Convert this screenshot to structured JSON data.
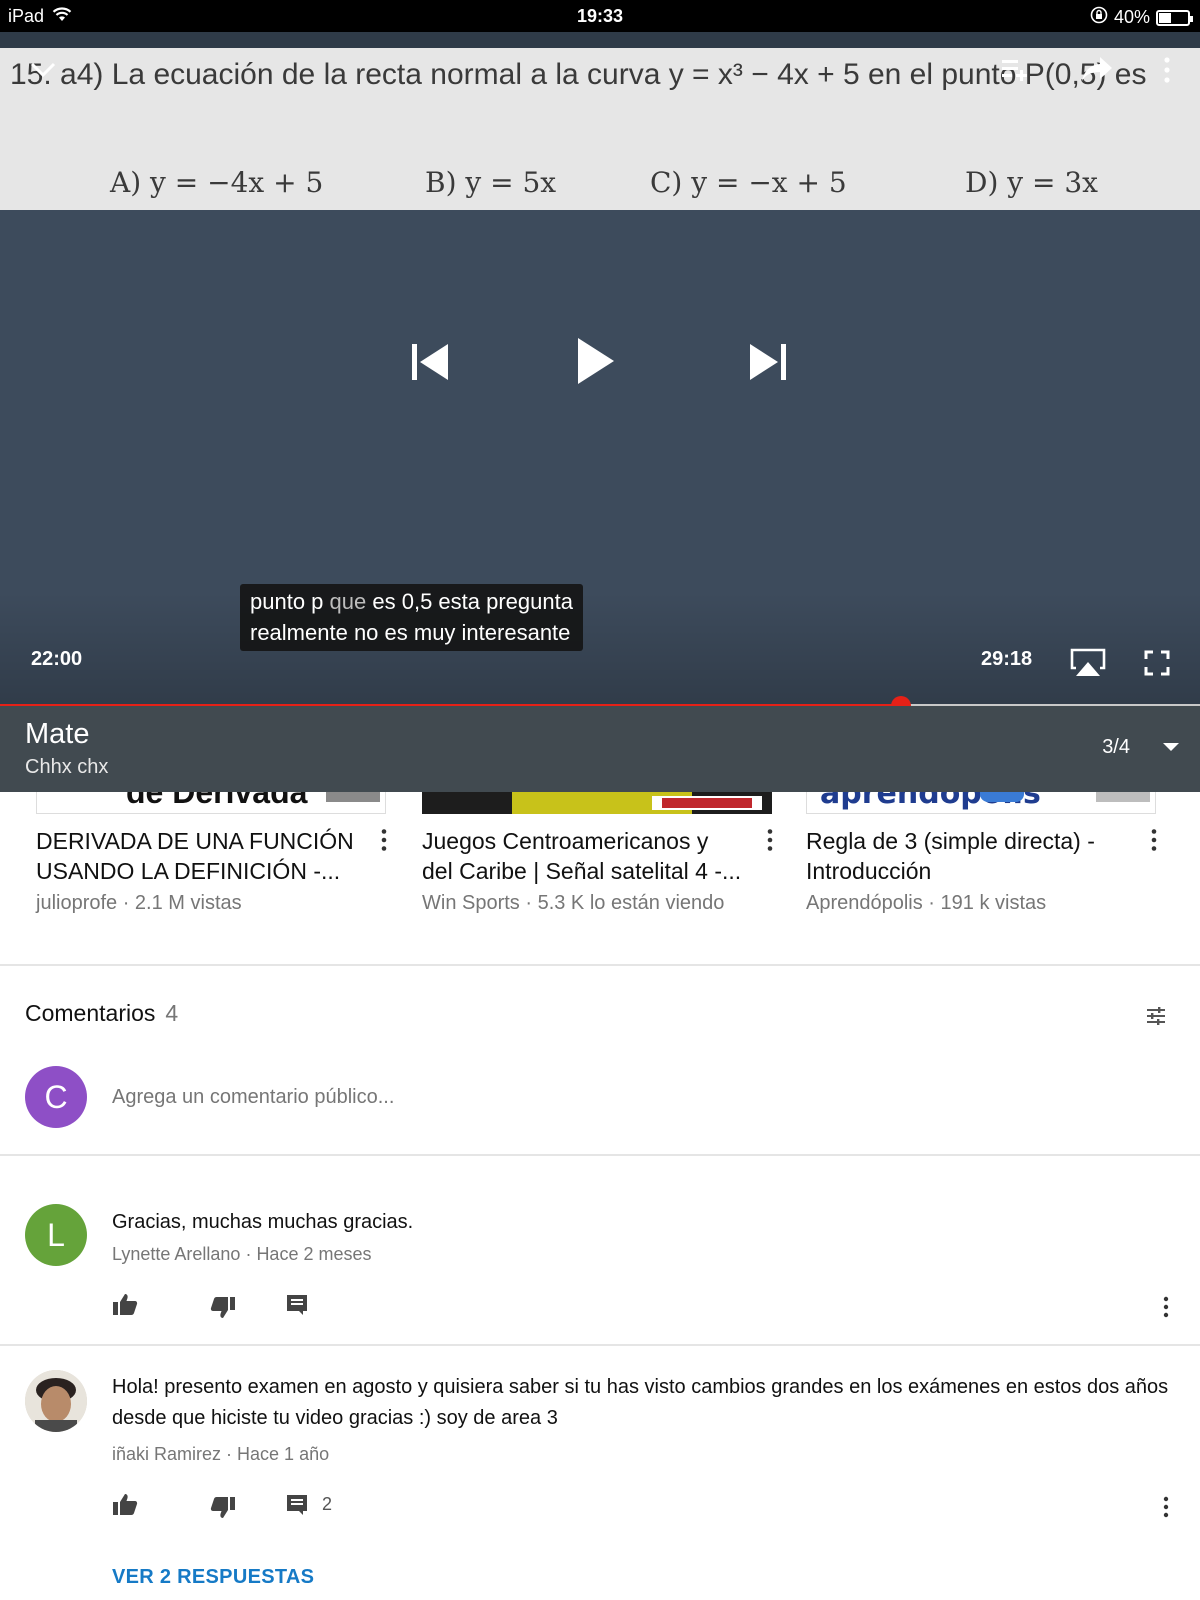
{
  "status_bar": {
    "device": "iPad",
    "time": "19:33",
    "battery": "40%",
    "battery_level": 0.4
  },
  "video": {
    "slide": {
      "question": "15. a4) La ecuación de la recta normal a la curva y = x³ − 4x + 5 en el punto P(0,5) es",
      "options": [
        "A) y = −4x + 5",
        "B) y = 5x",
        "C) y = −x + 5",
        "D) y = 3x"
      ]
    },
    "caption_line1_a": "punto p",
    "caption_line1_b": "que",
    "caption_line1_c": "es 0,5 esta pregunta",
    "caption_line2": "realmente no es muy interesante",
    "current_time": "22:00",
    "duration": "29:18",
    "progress": 0.7505
  },
  "playlist": {
    "title": "Mate",
    "owner": "Chhx chx",
    "position": "3/4"
  },
  "related": [
    {
      "title": "DERIVADA DE UNA FUNCIÓN USANDO LA DEFINICIÓN -...",
      "meta": "julioprofe · 2.1 M vistas",
      "thumb_text": "de Derivada"
    },
    {
      "title": "Juegos Centroamericanos y del Caribe | Señal satelital 4 -...",
      "meta": "Win Sports · 5.3 K lo están viendo",
      "thumb_text": ""
    },
    {
      "title": "Regla de 3 (simple directa) - Introducción",
      "meta": "Aprendópolis · 191 k vistas",
      "thumb_text": "aprendopolis"
    }
  ],
  "comments": {
    "header": "Comentarios",
    "count": "4",
    "add_placeholder": "Agrega un comentario público...",
    "user_initial": "C",
    "items": [
      {
        "initial": "L",
        "text": "Gracias, muchas muchas gracias.",
        "author": "Lynette Arellano",
        "when": "Hace 2 meses",
        "replies": ""
      },
      {
        "initial": "",
        "text": "Hola! presento examen en agosto y quisiera saber si tu has visto cambios grandes en los exámenes en estos dos años desde que hiciste tu video gracias :) soy de area 3",
        "author": "iñaki Ramirez",
        "when": "Hace 1 año",
        "replies": "2"
      }
    ],
    "view_replies": "VER 2 RESPUESTAS"
  },
  "colors": {
    "accent_red": "#e62117",
    "link_blue": "#167ac6",
    "avatar_c": "#8e4fc6",
    "avatar_l": "#65a33a"
  }
}
